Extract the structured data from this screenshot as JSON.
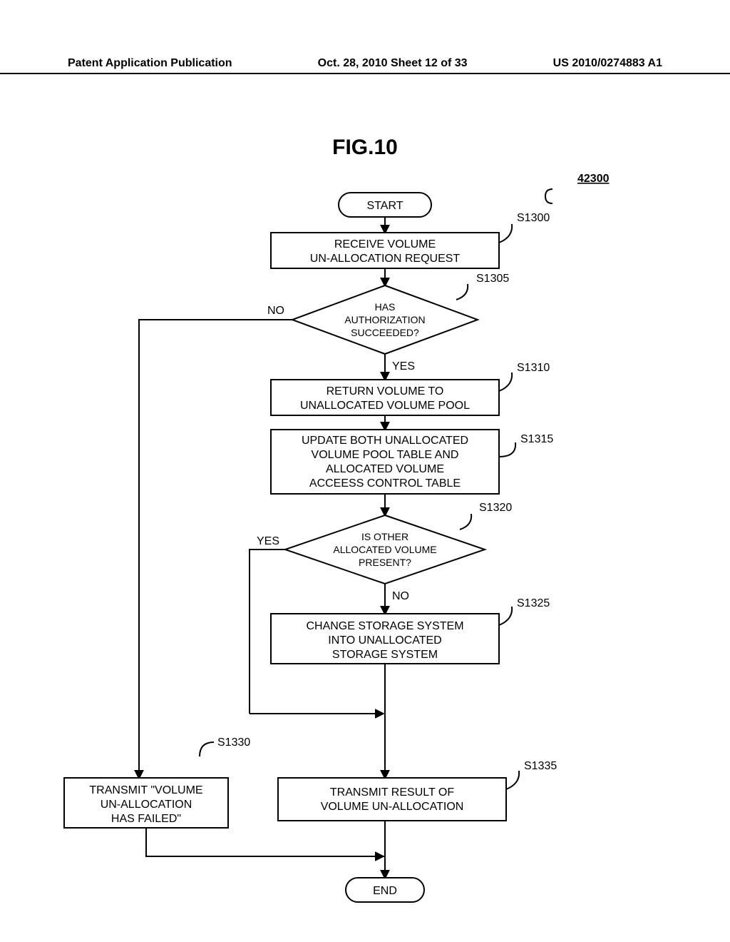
{
  "header": {
    "left": "Patent Application Publication",
    "center": "Oct. 28, 2010  Sheet 12 of 33",
    "right": "US 2010/0274883 A1"
  },
  "figure": "FIG.10",
  "procRef": "42300",
  "start": "START",
  "end": "END",
  "steps": {
    "s1300": {
      "ref": "S1300",
      "text1": "RECEIVE VOLUME",
      "text2": "UN-ALLOCATION REQUEST"
    },
    "s1305": {
      "ref": "S1305",
      "text1": "HAS",
      "text2": "AUTHORIZATION",
      "text3": "SUCCEEDED?"
    },
    "s1310": {
      "ref": "S1310",
      "text1": "RETURN VOLUME TO",
      "text2": "UNALLOCATED VOLUME POOL"
    },
    "s1315": {
      "ref": "S1315",
      "text1": "UPDATE BOTH UNALLOCATED",
      "text2": "VOLUME POOL TABLE AND",
      "text3": "ALLOCATED VOLUME",
      "text4": "ACCEESS CONTROL TABLE"
    },
    "s1320": {
      "ref": "S1320",
      "text1": "IS OTHER",
      "text2": "ALLOCATED VOLUME",
      "text3": "PRESENT?"
    },
    "s1325": {
      "ref": "S1325",
      "text1": "CHANGE STORAGE SYSTEM",
      "text2": "INTO UNALLOCATED",
      "text3": "STORAGE SYSTEM"
    },
    "s1330": {
      "ref": "S1330",
      "text1": "TRANSMIT \"VOLUME",
      "text2": "UN-ALLOCATION",
      "text3": "HAS FAILED\""
    },
    "s1335": {
      "ref": "S1335",
      "text1": "TRANSMIT RESULT OF",
      "text2": "VOLUME UN-ALLOCATION"
    }
  },
  "labels": {
    "yes": "YES",
    "no": "NO"
  }
}
